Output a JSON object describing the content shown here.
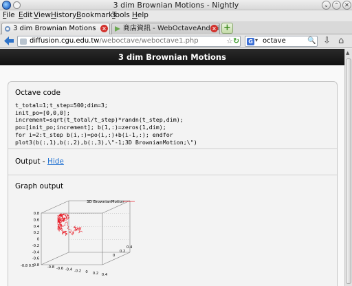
{
  "window": {
    "title": "3 dim Brownian Motions - Nightly",
    "buttons": {
      "minimize": "⌄",
      "maximize": "⌃",
      "close": "✕"
    }
  },
  "menubar": {
    "items": [
      {
        "label": "File",
        "key": "F",
        "rest": "ile"
      },
      {
        "label": "Edit",
        "key": "E",
        "rest": "dit"
      },
      {
        "label": "View",
        "key": "V",
        "rest": "iew"
      },
      {
        "label": "History",
        "key": "H",
        "rest": "istory"
      },
      {
        "label": "Bookmarks",
        "key": "B",
        "rest": "ookmarks"
      },
      {
        "label": "Tools",
        "key": "T",
        "rest": "ools"
      },
      {
        "label": "Help",
        "key": "H",
        "rest": "elp"
      }
    ]
  },
  "tabs": [
    {
      "label": "3 dim Brownian Motions",
      "active": true,
      "close": "×"
    },
    {
      "label": "商店資訊 - WebOctaveAndroid...",
      "active": false,
      "close": "×"
    }
  ],
  "new_tab_label": "+",
  "navbar": {
    "back_icon": "back-arrow-icon",
    "url_host": "diffusion.cgu.edu.tw",
    "url_path": "/weboctave/weboctave1.php",
    "star": "☆",
    "reload": "↻",
    "search_engine": "G",
    "search_query": "octave"
  },
  "page": {
    "header_title": "3 dim Brownian Motions",
    "octave_heading": "Octave code",
    "code_lines": [
      "t_total=1;t_step=500;dim=3;",
      "init_po=[0,0,0];",
      "increment=sqrt(t_total/t_step)*randn(t_step,dim);",
      "po=[init_po;increment]; b(1,:)=zeros(1,dim);",
      "for i=2:t_step b(i,:)=po(i,:)+b(i-1,:); endfor",
      "plot3(b(:,1),b(:,2),b(:,3),\\\"-1;3D BrownianMotion;\\\")"
    ],
    "output_heading": "Output - ",
    "hide_link": "Hide",
    "graph_heading": "Graph output"
  },
  "chart_data": {
    "type": "line",
    "title": "",
    "legend": "3D BrownianMotion",
    "series_color": "#e8202a",
    "z_ticks": [
      "0.8",
      "0.6",
      "0.4",
      "0.2",
      "0",
      "-0.2",
      "-0.4",
      "-0.6",
      "-0.8"
    ],
    "y_ticks": [
      "-0.8",
      "-0.6",
      "-0.4",
      "-0.2",
      "0",
      "0.2",
      "0.4"
    ],
    "x_ticks": [
      "0",
      "0.2",
      "0.4"
    ],
    "corner_label": "-0.8 0.5"
  }
}
